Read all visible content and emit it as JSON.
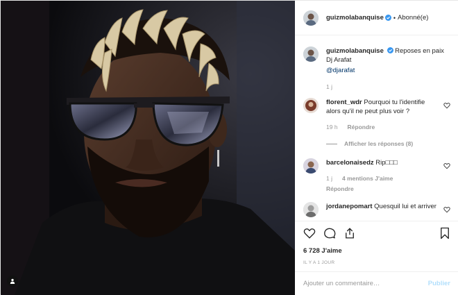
{
  "post": {
    "author": "guizmolabanquise",
    "follow_status": "Abonné(e)",
    "separator": "•"
  },
  "caption": {
    "username": "guizmolabanquise",
    "text_line1": "Reposes en paix",
    "text_line2": "Dj Arafat",
    "mention": "@djarafat",
    "time": "1 j"
  },
  "comments": [
    {
      "username": "florent_wdr",
      "text": "Pourquoi tu l'identifie alors qu'il ne peut plus voir ?",
      "time": "19 h",
      "reply_label": "Répondre",
      "view_replies": "Afficher les réponses (8)"
    },
    {
      "username": "barcelonaisedz",
      "text": "Rip□□□",
      "time": "1 j",
      "likes": "4 mentions J'aime",
      "reply_label": "Répondre"
    },
    {
      "username": "jordanepomart",
      "text": "Quesquil lui et arriver"
    }
  ],
  "likes": {
    "count": "6 728",
    "label": "J'aime"
  },
  "timestamp": "IL Y A 1 JOUR",
  "comment_box": {
    "placeholder": "Ajouter un commentaire…",
    "publish_label": "Publier"
  },
  "icons": [
    "heart-icon",
    "comment-icon",
    "share-icon",
    "bookmark-icon",
    "user-tag-icon",
    "verified-badge-icon"
  ],
  "colors": {
    "verified": "#3897f0",
    "link": "#003569",
    "muted": "#999999",
    "publish_disabled": "#b2dffc"
  }
}
